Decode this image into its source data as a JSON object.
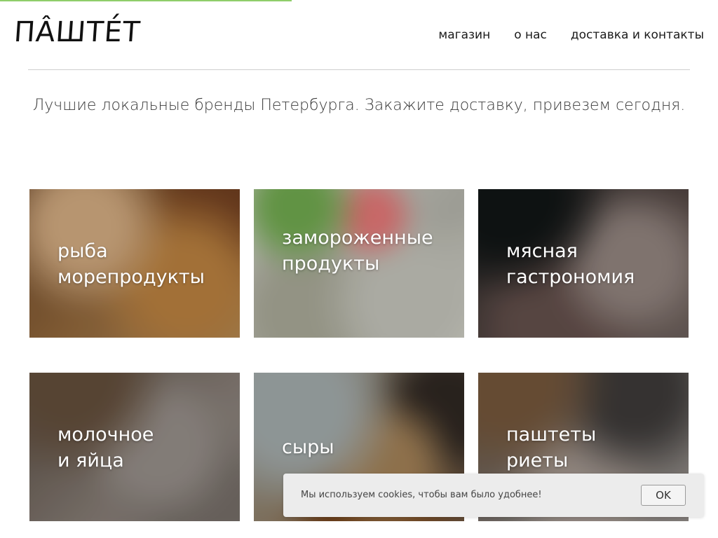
{
  "progress": 0.41,
  "header": {
    "logo": "ПÂШТЕ́Т",
    "nav": [
      {
        "label": "магазин"
      },
      {
        "label": "о нас"
      },
      {
        "label": "доставка и контакты"
      }
    ]
  },
  "tagline": "Лучшие локальные бренды Петербурга. Закажите доставку, привезем сегодня.",
  "categories": [
    {
      "line1": "рыба",
      "line2": "морепродукты"
    },
    {
      "line1": "замороженные",
      "line2": "продукты"
    },
    {
      "line1": "мясная",
      "line2": "гастрономия"
    },
    {
      "line1": "молочное",
      "line2": "и яйца"
    },
    {
      "line1": "сыры",
      "line2": ""
    },
    {
      "line1": "паштеты",
      "line2": "риеты"
    }
  ],
  "cookie_banner": {
    "text": "Мы используем cookies, чтобы вам было удобнее!",
    "ok_label": "OK"
  },
  "colors": {
    "progress_bar": "#8fce6a",
    "divider": "#cfcfcf",
    "cookie_bg": "#ececec"
  }
}
